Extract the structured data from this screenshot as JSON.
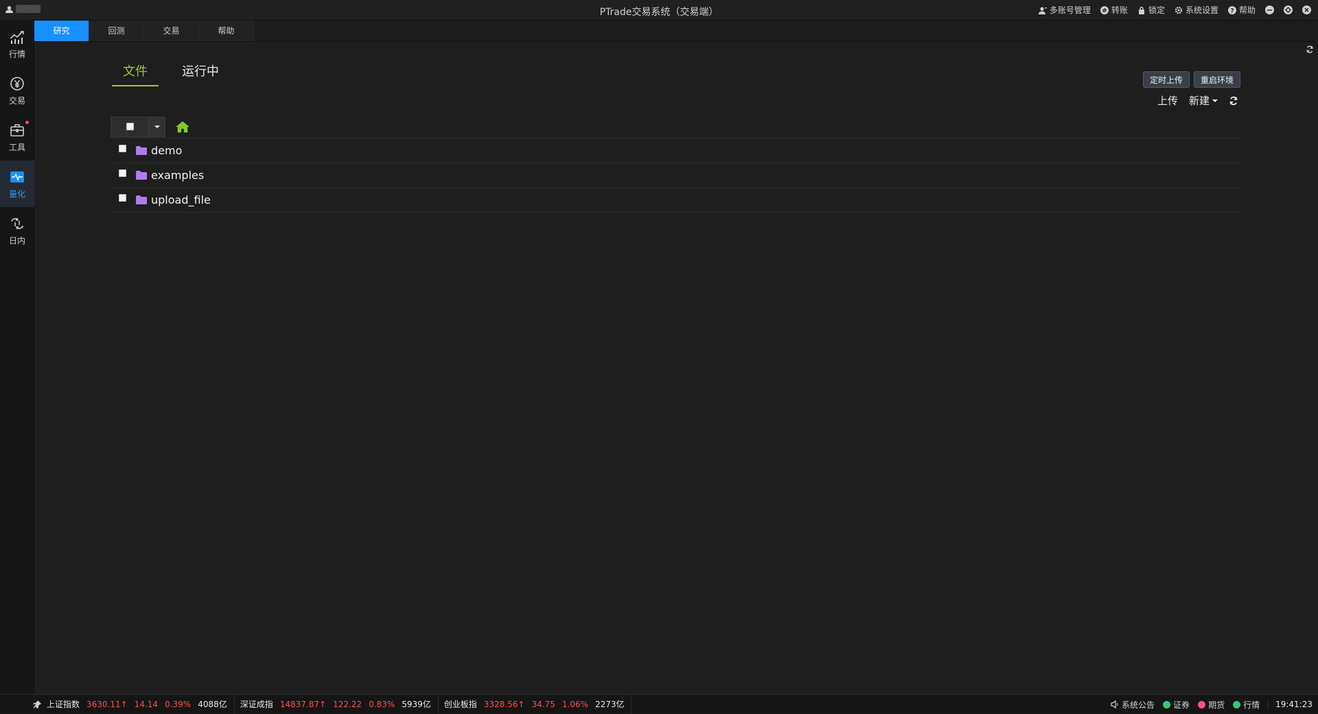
{
  "window": {
    "title": "PTrade交易系统（交易端）",
    "menu": [
      {
        "icon": "user-manage-icon",
        "label": "多账号管理"
      },
      {
        "icon": "transfer-icon",
        "label": "转账"
      },
      {
        "icon": "lock-icon",
        "label": "锁定"
      },
      {
        "icon": "gear-icon",
        "label": "系统设置"
      },
      {
        "icon": "help-icon",
        "label": "帮助"
      }
    ]
  },
  "sidebar": {
    "items": [
      {
        "icon": "market-chart-icon",
        "label": "行情"
      },
      {
        "icon": "yen-trade-icon",
        "label": "交易"
      },
      {
        "icon": "toolbox-icon",
        "label": "工具"
      },
      {
        "icon": "quant-icon",
        "label": "量化"
      },
      {
        "icon": "intraday-icon",
        "label": "日内"
      }
    ]
  },
  "tabs": [
    "研究",
    "回测",
    "交易",
    "帮助"
  ],
  "main": {
    "subtabs": [
      "文件",
      "运行中"
    ],
    "buttons": {
      "scheduled_upload": "定时上传",
      "restart_env": "重启环境"
    },
    "actions": {
      "upload": "上传",
      "new": "新建"
    },
    "files": [
      {
        "name": "demo",
        "type": "folder"
      },
      {
        "name": "examples",
        "type": "folder"
      },
      {
        "name": "upload_file",
        "type": "folder"
      }
    ]
  },
  "statusbar": {
    "indices": [
      {
        "name": "上证指数",
        "price": "3630.11",
        "change": "14.14",
        "pct": "0.39%",
        "volume": "4088亿"
      },
      {
        "name": "深证成指",
        "price": "14837.87",
        "change": "122.22",
        "pct": "0.83%",
        "volume": "5939亿"
      },
      {
        "name": "创业板指",
        "price": "3328.56",
        "change": "34.75",
        "pct": "1.06%",
        "volume": "2273亿"
      }
    ],
    "announcement": "系统公告",
    "statuses": [
      {
        "label": "证券",
        "color": "#2ecc71"
      },
      {
        "label": "期货",
        "color": "#ff4d88"
      },
      {
        "label": "行情",
        "color": "#2ecc71"
      }
    ],
    "time": "19:41:23"
  },
  "colors": {
    "accent": "#1890ff",
    "active_subtab": "#9ecb2c",
    "up": "#ff4d4d",
    "folder": "#b07de8",
    "home": "#7ec82a"
  }
}
